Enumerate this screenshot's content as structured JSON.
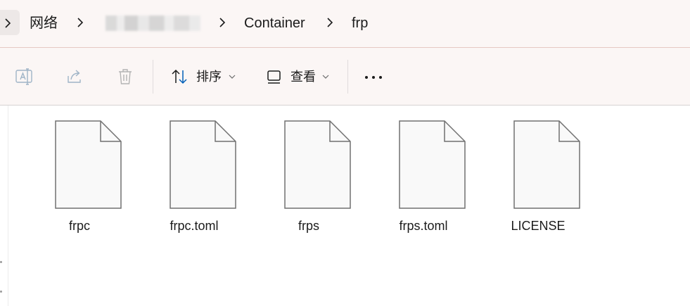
{
  "breadcrumb": {
    "items": [
      {
        "label": "网络"
      },
      {
        "label": ""
      },
      {
        "label": "Container"
      },
      {
        "label": "frp"
      }
    ]
  },
  "toolbar": {
    "sort_label": "排序",
    "view_label": "查看",
    "icons": [
      "rename-icon",
      "share-icon",
      "delete-icon",
      "sort-icon",
      "view-icon",
      "more-icon"
    ]
  },
  "files": [
    {
      "name": "frpc"
    },
    {
      "name": "frpc.toml"
    },
    {
      "name": "frps"
    },
    {
      "name": "frps.toml"
    },
    {
      "name": "LICENSE"
    }
  ],
  "colors": {
    "accent": "#005fb8",
    "header_bg": "#fbf6f5",
    "file_outline": "#707070"
  }
}
